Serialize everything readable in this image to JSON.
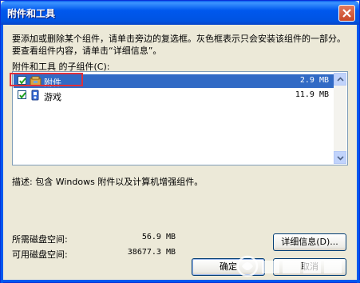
{
  "window": {
    "title": "附件和工具"
  },
  "description": "要添加或删除某个组件，请单击旁边的复选框。灰色框表示只会安装该组件的一部分。要查看组件内容，请单击“详细信息”。",
  "subcomponents_label": "附件和工具 的子组件(C):",
  "components": [
    {
      "name": "附件",
      "size": "2.9 MB",
      "checked": true,
      "selected": true,
      "icon": "accessories-icon"
    },
    {
      "name": "游戏",
      "size": "11.9 MB",
      "checked": true,
      "selected": false,
      "icon": "games-icon"
    }
  ],
  "component_description": "描述:  包含 Windows 附件以及计算机增强组件。",
  "disk": {
    "required_label": "所需磁盘空间:",
    "required_value": "56.9 MB",
    "available_label": "可用磁盘空间:",
    "available_value": "38677.3 MB"
  },
  "buttons": {
    "details": "详细信息(D)...",
    "ok": "确定",
    "cancel": "取消"
  },
  "colors": {
    "titlebar": "#0058EE",
    "selection": "#316AC5",
    "highlight_box": "#E0303A",
    "background": "#ECE9D8"
  }
}
